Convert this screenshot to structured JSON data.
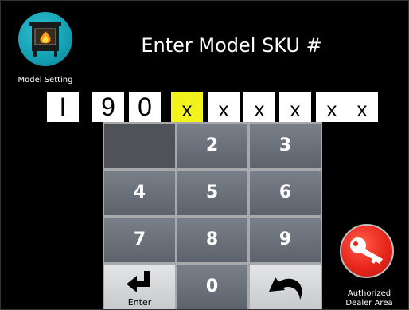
{
  "header": {
    "title": "Enter Model SKU #",
    "model_setting_label": "Model Setting",
    "model_icon": "stove-flame-icon"
  },
  "sku": {
    "digits": [
      "I",
      "9",
      "0",
      "x",
      "x",
      "x",
      "x",
      "x",
      "x"
    ],
    "active_index": 3
  },
  "keypad": {
    "keys": [
      "",
      "2",
      "3",
      "4",
      "5",
      "6",
      "7",
      "8",
      "9",
      "enter",
      "0",
      "back"
    ],
    "enter_label": "Enter",
    "enter_icon": "enter-arrow-icon",
    "back_icon": "undo-arrow-icon"
  },
  "dealer": {
    "label_line1": "Authorized",
    "label_line2": "Dealer Area",
    "icon": "key-icon"
  },
  "colors": {
    "background": "#000000",
    "highlight": "#f2f21c",
    "model_teal": "#139fb2",
    "dealer_red": "#e8261b",
    "key_dark": "#5d636c"
  }
}
